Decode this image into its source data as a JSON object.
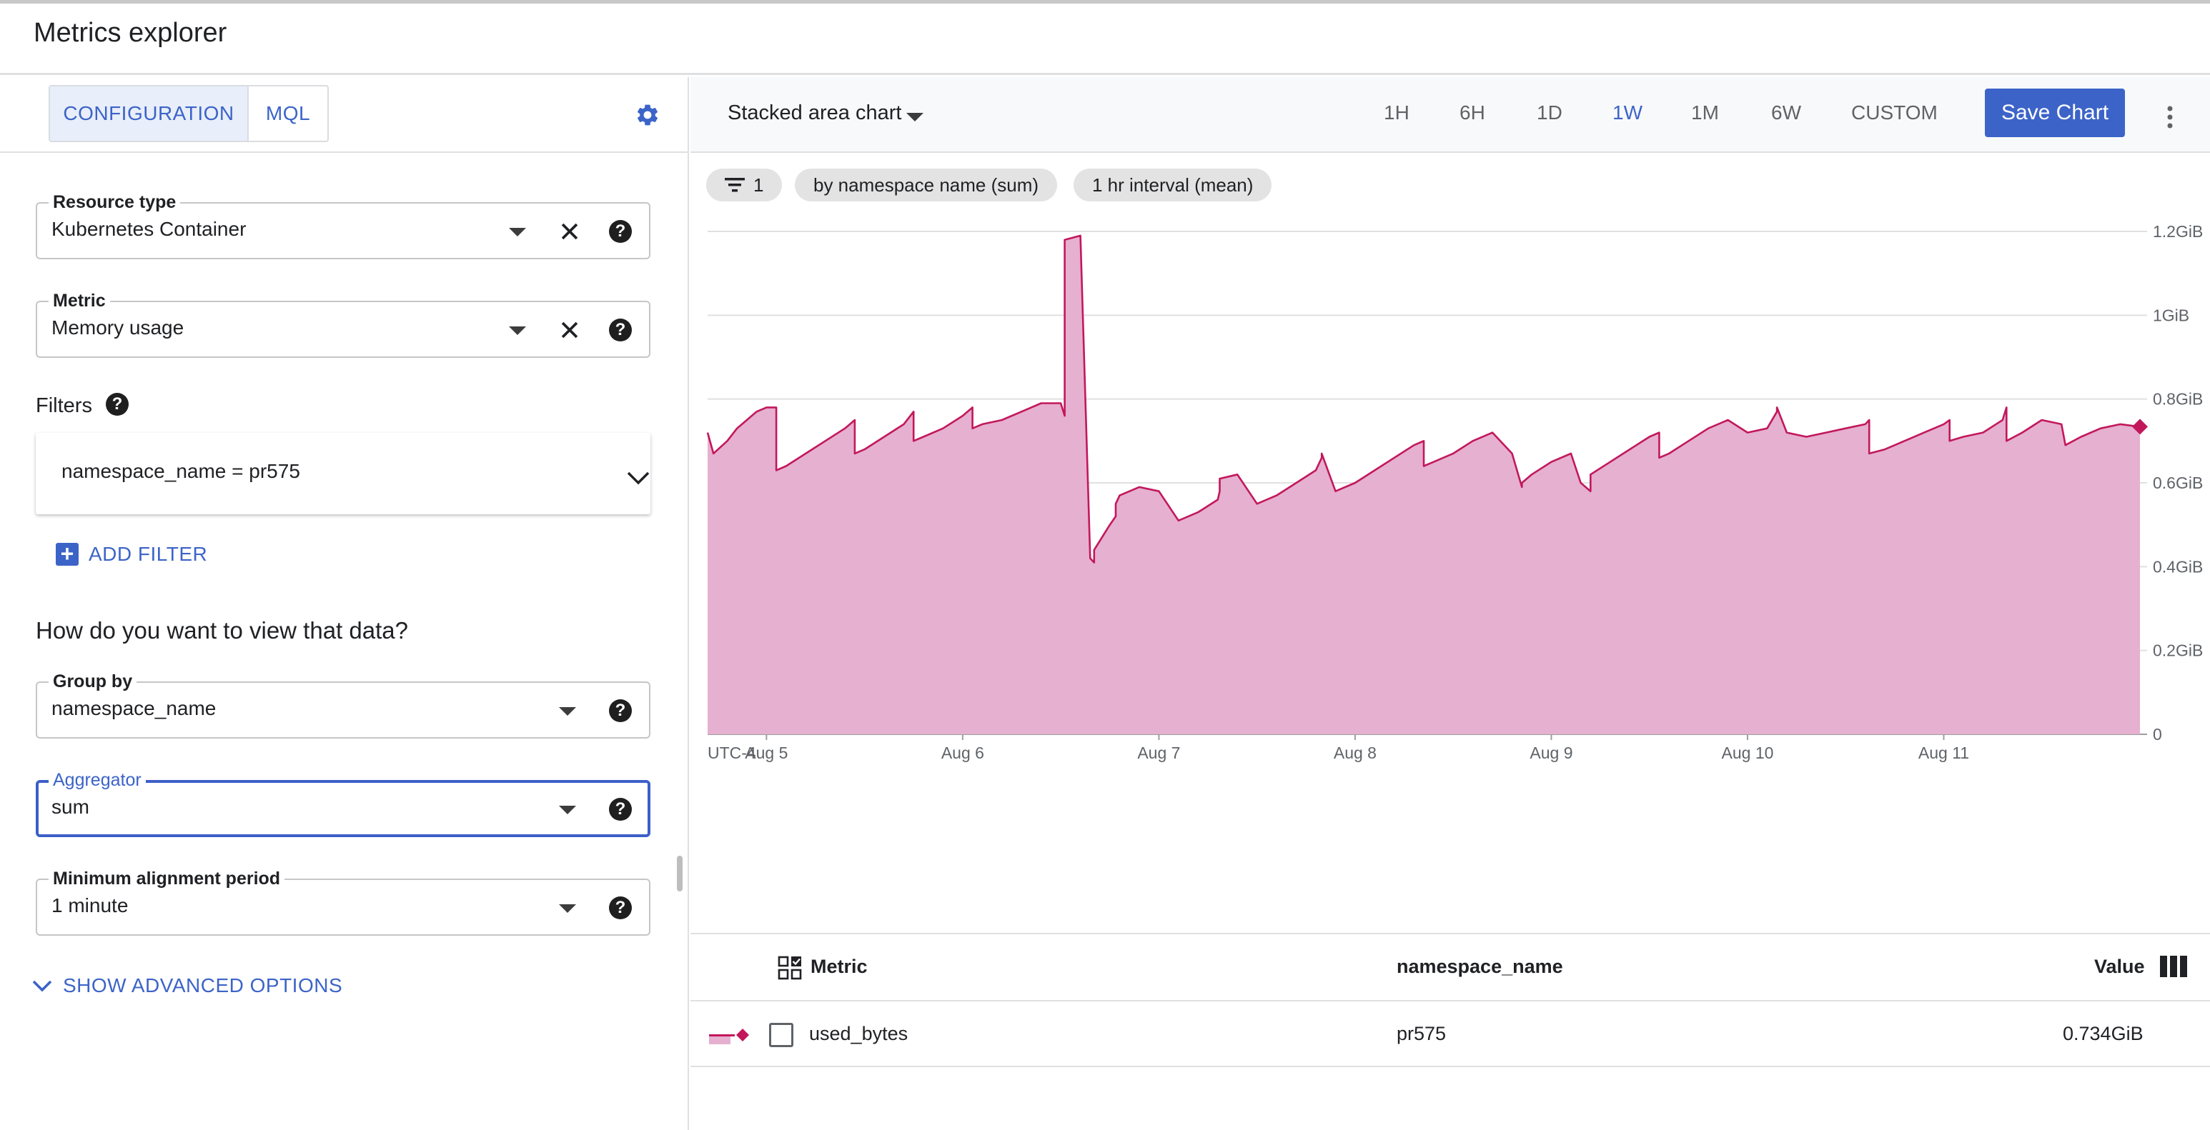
{
  "app": {
    "title": "Metrics explorer"
  },
  "config": {
    "tabs": [
      {
        "label": "CONFIGURATION",
        "active": true
      },
      {
        "label": "MQL",
        "active": false
      }
    ],
    "settings_icon": "gear-icon",
    "resource_type": {
      "label": "Resource type",
      "value": "Kubernetes Container"
    },
    "metric": {
      "label": "Metric",
      "value": "Memory usage"
    },
    "filters": {
      "label": "Filters",
      "items": [
        "namespace_name = pr575"
      ],
      "add_label": "ADD FILTER"
    },
    "view_question": "How do you want to view that data?",
    "group_by": {
      "label": "Group by",
      "value": "namespace_name"
    },
    "aggregator": {
      "label": "Aggregator",
      "value": "sum"
    },
    "alignment": {
      "label": "Minimum alignment period",
      "value": "1 minute"
    },
    "advanced_label": "SHOW ADVANCED OPTIONS"
  },
  "toolbar": {
    "chart_type": "Stacked area chart",
    "ranges": [
      "1H",
      "6H",
      "1D",
      "1W",
      "1M",
      "6W",
      "CUSTOM"
    ],
    "active_range": "1W",
    "save_label": "Save Chart"
  },
  "chips": {
    "filter_count": "1",
    "grouping": "by namespace name (sum)",
    "interval": "1 hr interval (mean)"
  },
  "chart_data": {
    "type": "area",
    "timezone_label": "UTC-4",
    "x_ticks": [
      "Aug 5",
      "Aug 6",
      "Aug 7",
      "Aug 8",
      "Aug 9",
      "Aug 10",
      "Aug 11"
    ],
    "y_ticks": [
      "0",
      "0.2GiB",
      "0.4GiB",
      "0.6GiB",
      "0.8GiB",
      "1GiB",
      "1.2GiB"
    ],
    "ylim": [
      0,
      1.2
    ],
    "y_unit": "GiB",
    "color": "#c2185b",
    "fill": "#e6b0d0",
    "series": [
      {
        "x": [
          4.7,
          4.73,
          4.8,
          4.85,
          4.9,
          4.95,
          5.0,
          5.05,
          5.05,
          5.1,
          5.2,
          5.3,
          5.4,
          5.45,
          5.45,
          5.5,
          5.6,
          5.7,
          5.75,
          5.75,
          5.8,
          5.9,
          6.0,
          6.05,
          6.05,
          6.1,
          6.2,
          6.3,
          6.4,
          6.5,
          6.52,
          6.52,
          6.6,
          6.65,
          6.67,
          6.67,
          6.75,
          6.78,
          6.78,
          6.8,
          6.9,
          7.0,
          7.1,
          7.2,
          7.3,
          7.31,
          7.31,
          7.4,
          7.5,
          7.6,
          7.7,
          7.8,
          7.83,
          7.83,
          7.9,
          8.0,
          8.1,
          8.2,
          8.3,
          8.35,
          8.35,
          8.4,
          8.5,
          8.6,
          8.7,
          8.8,
          8.85,
          8.85,
          8.9,
          9.0,
          9.1,
          9.15,
          9.2,
          9.2,
          9.3,
          9.4,
          9.5,
          9.55,
          9.55,
          9.6,
          9.7,
          9.8,
          9.9,
          10.0,
          10.1,
          10.15,
          10.15,
          10.2,
          10.3,
          10.4,
          10.5,
          10.6,
          10.62,
          10.62,
          10.7,
          10.8,
          10.9,
          11.0,
          11.03,
          11.03,
          11.1,
          11.2,
          11.3,
          11.32,
          11.32,
          11.4,
          11.5,
          11.6,
          11.62,
          11.62,
          11.7,
          11.8,
          11.9,
          12.0
        ],
        "values": [
          0.72,
          0.67,
          0.7,
          0.73,
          0.75,
          0.77,
          0.78,
          0.78,
          0.63,
          0.64,
          0.67,
          0.7,
          0.73,
          0.75,
          0.67,
          0.68,
          0.71,
          0.74,
          0.77,
          0.7,
          0.71,
          0.73,
          0.76,
          0.78,
          0.73,
          0.74,
          0.75,
          0.77,
          0.79,
          0.79,
          0.76,
          1.18,
          1.19,
          0.42,
          0.41,
          0.44,
          0.5,
          0.52,
          0.55,
          0.57,
          0.59,
          0.58,
          0.51,
          0.53,
          0.56,
          0.58,
          0.61,
          0.62,
          0.55,
          0.57,
          0.6,
          0.63,
          0.66,
          0.67,
          0.58,
          0.6,
          0.63,
          0.66,
          0.69,
          0.7,
          0.64,
          0.65,
          0.67,
          0.7,
          0.72,
          0.67,
          0.59,
          0.6,
          0.62,
          0.65,
          0.67,
          0.6,
          0.58,
          0.62,
          0.65,
          0.68,
          0.71,
          0.72,
          0.66,
          0.67,
          0.7,
          0.73,
          0.75,
          0.72,
          0.73,
          0.77,
          0.78,
          0.72,
          0.71,
          0.72,
          0.73,
          0.74,
          0.75,
          0.67,
          0.68,
          0.7,
          0.72,
          0.74,
          0.75,
          0.7,
          0.71,
          0.72,
          0.75,
          0.78,
          0.7,
          0.72,
          0.75,
          0.74,
          0.69,
          0.69,
          0.71,
          0.73,
          0.74,
          0.734
        ]
      }
    ]
  },
  "table": {
    "columns": {
      "metric": "Metric",
      "namespace": "namespace_name",
      "value": "Value"
    },
    "rows": [
      {
        "metric": "used_bytes",
        "namespace": "pr575",
        "value": "0.734GiB"
      }
    ]
  }
}
